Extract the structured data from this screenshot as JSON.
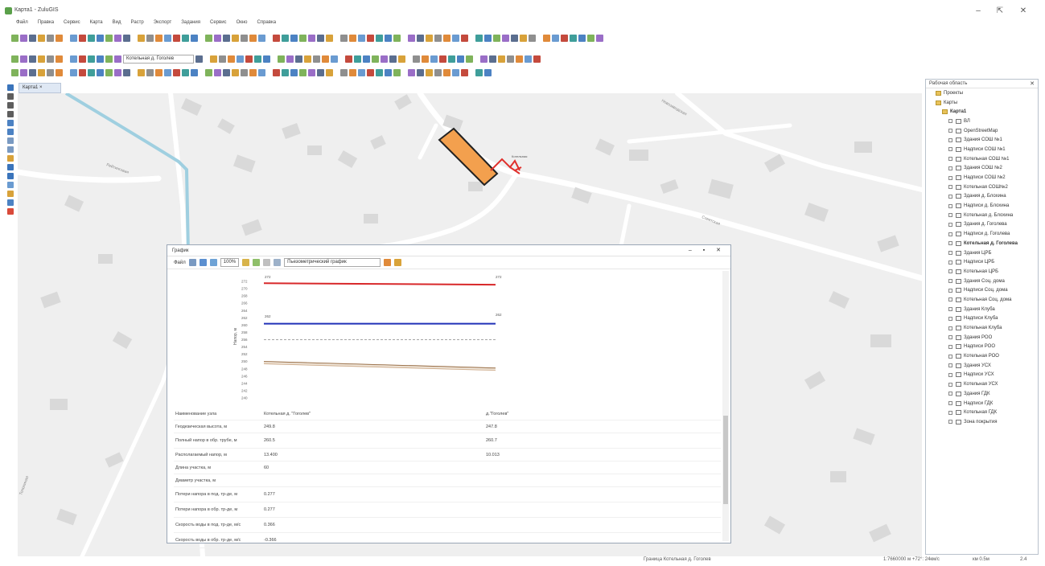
{
  "window": {
    "title": "Карта1 - ZuluGIS",
    "controls": [
      "‒",
      "⇱",
      "✕"
    ]
  },
  "menu": [
    "Файл",
    "Правка",
    "Сервис",
    "Карта",
    "Вид",
    "Растр",
    "Экспорт",
    "Задания",
    "Сервис",
    "Окно",
    "Справка"
  ],
  "toolbar2": {
    "layer_combo": "Котельная д. Гоголев"
  },
  "map_tab": {
    "label": "Карта1 ×"
  },
  "map": {
    "street_labels": [
      "Рейтинговая",
      "Новозаводская",
      "Советская",
      "Тополиная"
    ],
    "object_label": "Котельная"
  },
  "graph": {
    "title": "График",
    "controls": [
      "–",
      "▪",
      "✕"
    ],
    "toolbar": {
      "file_label": "Файл",
      "zoom_value": "100%",
      "type_combo": "Пьезометрический график"
    },
    "y_axis_label": "Напор, м",
    "left_node_top": "272",
    "right_node_top": "272",
    "left_node_mid": "262",
    "right_node_mid": "262",
    "table": [
      {
        "name": "Наименование узла",
        "a": "Котельная д. \"Гоголев\"",
        "b": "д.\"Гоголев\"",
        "tall": false
      },
      {
        "name": "Геодезическая высота, м",
        "a": "249.8",
        "b": "247.8",
        "tall": false
      },
      {
        "name": "Полный напор в обр. трубе, м",
        "a": "260.5",
        "b": "260.7",
        "tall": true
      },
      {
        "name": "Располагаемый напор, м",
        "a": "13.400",
        "b": "10.013",
        "tall": false
      },
      {
        "name": "Длина участка, м",
        "a": "60",
        "b": "",
        "tall": false
      },
      {
        "name": "Диаметр участка, м",
        "a": "",
        "b": "",
        "tall": false
      },
      {
        "name": "Потери напора в под. тр-де, м",
        "a": "0.277",
        "b": "",
        "tall": true
      },
      {
        "name": "Потери напора в обр. тр-де, м",
        "a": "0.277",
        "b": "",
        "tall": true
      },
      {
        "name": "Скорость воды в под. тр-де, м/с",
        "a": "0.366",
        "b": "",
        "tall": true
      },
      {
        "name": "Скорость воды в обр. тр-де, м/с",
        "a": "-0.366",
        "b": "",
        "tall": true
      }
    ]
  },
  "chart_data": {
    "type": "line",
    "title": "",
    "xlabel": "",
    "ylabel": "Напор, м",
    "ylim": [
      240,
      272
    ],
    "y_ticks": [
      "272",
      "270",
      "268",
      "266",
      "264",
      "262",
      "260",
      "258",
      "256",
      "254",
      "252",
      "250",
      "248",
      "246",
      "244",
      "242",
      "240"
    ],
    "x": [
      0,
      60
    ],
    "series": [
      {
        "values": [
          271.5,
          271.1
        ],
        "color": "#d8282a"
      },
      {
        "values": [
          260.4,
          260.4
        ],
        "color": "#2132b8"
      },
      {
        "values": [
          256.0,
          256.0
        ],
        "color": "#888888"
      },
      {
        "values": [
          250.0,
          248.2
        ],
        "color": "#8a5a2e"
      },
      {
        "values": [
          249.4,
          247.6
        ],
        "color": "#caa684"
      }
    ]
  },
  "layers_panel": {
    "title": "Рабочая область",
    "items": [
      {
        "label": "Проекты",
        "indent": 1,
        "type": "folder"
      },
      {
        "label": "Карты",
        "indent": 1,
        "type": "folder"
      },
      {
        "label": "Карта1",
        "indent": 2,
        "type": "map",
        "bold": true
      },
      {
        "label": "ВЛ",
        "indent": 3,
        "type": "layer"
      },
      {
        "label": "OpenStreetMap",
        "indent": 3,
        "type": "layer"
      },
      {
        "label": "Здания СОШ №1",
        "indent": 3,
        "type": "layer"
      },
      {
        "label": "Надписи СОШ №1",
        "indent": 3,
        "type": "layer"
      },
      {
        "label": "Котельная СОШ №1",
        "indent": 3,
        "type": "layer"
      },
      {
        "label": "Здания СОШ №2",
        "indent": 3,
        "type": "layer"
      },
      {
        "label": "Надписи СОШ №2",
        "indent": 3,
        "type": "layer"
      },
      {
        "label": "Котельная СОШ№2",
        "indent": 3,
        "type": "layer"
      },
      {
        "label": "Здания д. Блохина",
        "indent": 3,
        "type": "layer"
      },
      {
        "label": "Надписи д. Блохина",
        "indent": 3,
        "type": "layer"
      },
      {
        "label": "Котельная д. Блохина",
        "indent": 3,
        "type": "layer"
      },
      {
        "label": "Здания д. Гоголева",
        "indent": 3,
        "type": "layer"
      },
      {
        "label": "Надписи д. Гоголева",
        "indent": 3,
        "type": "layer"
      },
      {
        "label": "Котельная д. Гоголева",
        "indent": 3,
        "type": "layer",
        "bold": true
      },
      {
        "label": "Здания ЦРБ",
        "indent": 3,
        "type": "layer"
      },
      {
        "label": "Надписи ЦРБ",
        "indent": 3,
        "type": "layer"
      },
      {
        "label": "Котельная ЦРБ",
        "indent": 3,
        "type": "layer"
      },
      {
        "label": "Здания Соц. дома",
        "indent": 3,
        "type": "layer"
      },
      {
        "label": "Надписи Соц. дома",
        "indent": 3,
        "type": "layer"
      },
      {
        "label": "Котельная Соц. дома",
        "indent": 3,
        "type": "layer"
      },
      {
        "label": "Здания Клуба",
        "indent": 3,
        "type": "layer"
      },
      {
        "label": "Надписи Клуба",
        "indent": 3,
        "type": "layer"
      },
      {
        "label": "Котельная Клуба",
        "indent": 3,
        "type": "layer"
      },
      {
        "label": "Здания РОО",
        "indent": 3,
        "type": "layer"
      },
      {
        "label": "Надписи РОО",
        "indent": 3,
        "type": "layer"
      },
      {
        "label": "Котельная РОО",
        "indent": 3,
        "type": "layer"
      },
      {
        "label": "Здания УСХ",
        "indent": 3,
        "type": "layer"
      },
      {
        "label": "Надписи УСХ",
        "indent": 3,
        "type": "layer"
      },
      {
        "label": "Котельная УСХ",
        "indent": 3,
        "type": "layer"
      },
      {
        "label": "Здания ГДК",
        "indent": 3,
        "type": "layer"
      },
      {
        "label": "Надписи ГДК",
        "indent": 3,
        "type": "layer"
      },
      {
        "label": "Котельная ГДК",
        "indent": 3,
        "type": "layer"
      },
      {
        "label": "Зона покрытия",
        "indent": 3,
        "type": "layer"
      }
    ]
  },
  "statusbar": {
    "center": "Граница Котельная д. Гоголев",
    "scale": "1:7660000 м +72°: 24км/с",
    "coord": "км 0.5м",
    "page": "2.4"
  },
  "colors": {
    "accent": "#f0a04c",
    "river": "#9fcfe0",
    "map_bg": "#efefef"
  }
}
